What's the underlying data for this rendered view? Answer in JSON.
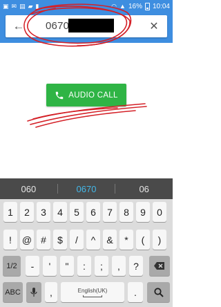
{
  "status_bar": {
    "battery_percent": "16%",
    "time": "10:04"
  },
  "search": {
    "number_visible": "0670",
    "number_redacted": true,
    "back_icon": "arrow-left-icon",
    "clear_icon": "close-icon"
  },
  "call": {
    "label": "AUDIO CALL",
    "icon": "phone-icon",
    "color": "#2fb445"
  },
  "suggestions": [
    "060",
    "0670",
    "06"
  ],
  "keyboard": {
    "row1": [
      "1",
      "2",
      "3",
      "4",
      "5",
      "6",
      "7",
      "8",
      "9",
      "0"
    ],
    "row2": [
      "!",
      "@",
      "#",
      "$",
      "/",
      "^",
      "&",
      "*",
      "(",
      ")"
    ],
    "row3": {
      "mode_label": "1/2",
      "keys": [
        "-",
        "'",
        "\"",
        ":",
        ";",
        ",",
        "?"
      ],
      "backspace_icon": "backspace-icon"
    },
    "row4": {
      "abc_label": "ABC",
      "mic_icon": "mic-icon",
      "comma": ",",
      "space_label": "English(UK)",
      "period": ".",
      "search_icon": "search-icon"
    }
  },
  "colors": {
    "app_bar": "#3e8ee0",
    "annotation_red": "#d42027",
    "suggestion_highlight": "#43b7e8"
  }
}
